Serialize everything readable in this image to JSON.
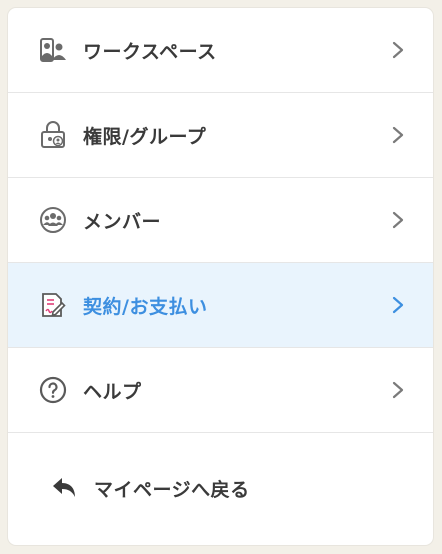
{
  "menu": {
    "items": [
      {
        "label": "ワークスペース",
        "icon": "workspace-icon",
        "active": false
      },
      {
        "label": "権限/グループ",
        "icon": "permissions-lock-icon",
        "active": false
      },
      {
        "label": "メンバー",
        "icon": "members-icon",
        "active": false
      },
      {
        "label": "契約/お支払い",
        "icon": "contract-document-icon",
        "active": true
      },
      {
        "label": "ヘルプ",
        "icon": "help-icon",
        "active": false
      }
    ],
    "back_label": "マイページへ戻る"
  },
  "colors": {
    "active_bg": "#e9f4fd",
    "active_text": "#3d8fe0",
    "text": "#3a3a3a",
    "icon": "#6b6b6b",
    "page_bg": "#f3f0e8"
  }
}
